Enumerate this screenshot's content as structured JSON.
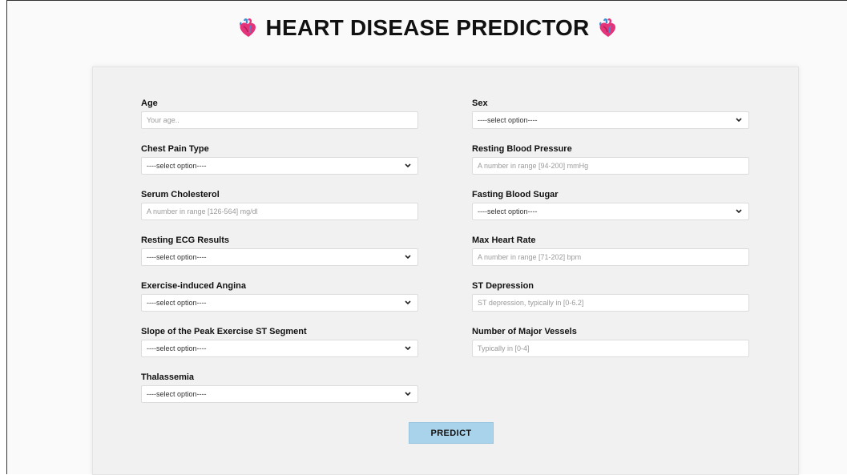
{
  "header": {
    "title": "HEART DISEASE PREDICTOR",
    "icon": "anatomical-heart-icon"
  },
  "form": {
    "age": {
      "label": "Age",
      "placeholder": "Your age.."
    },
    "sex": {
      "label": "Sex",
      "value": "----select option----"
    },
    "chest_pain": {
      "label": "Chest Pain Type",
      "value": "----select option----"
    },
    "resting_bp": {
      "label": "Resting Blood Pressure",
      "placeholder": "A number in range [94-200] mmHg"
    },
    "cholesterol": {
      "label": "Serum Cholesterol",
      "placeholder": "A number in range [126-564] mg/dl"
    },
    "fasting_sugar": {
      "label": "Fasting Blood Sugar",
      "value": "----select option----"
    },
    "resting_ecg": {
      "label": "Resting ECG Results",
      "value": "----select option----"
    },
    "max_hr": {
      "label": "Max Heart Rate",
      "placeholder": "A number in range [71-202] bpm"
    },
    "angina": {
      "label": "Exercise-induced Angina",
      "value": "----select option----"
    },
    "st_depression": {
      "label": "ST Depression",
      "placeholder": "ST depression, typically in [0-6.2]"
    },
    "slope": {
      "label": "Slope of the Peak Exercise ST Segment",
      "value": "----select option----"
    },
    "vessels": {
      "label": "Number of Major Vessels",
      "placeholder": "Typically in [0-4]"
    },
    "thal": {
      "label": "Thalassemia",
      "value": "----select option----"
    }
  },
  "predict_button": {
    "label": "PREDICT",
    "color": "#a9d3ea"
  },
  "colors": {
    "heart_pink": "#e5337a",
    "heart_blue": "#3f8fd6"
  }
}
